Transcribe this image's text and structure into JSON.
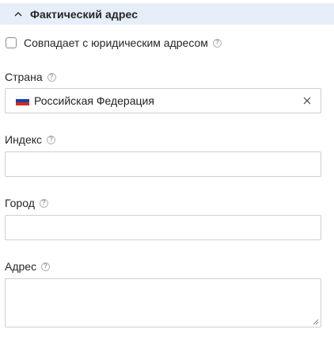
{
  "section": {
    "title": "Фактический адрес",
    "expanded": true
  },
  "same_as_legal": {
    "label": "Совпадает с юридическим адресом",
    "checked": false,
    "help": "?"
  },
  "country": {
    "label": "Страна",
    "help": "?",
    "value": "Российская Федерация",
    "flag_icon": "russia-flag-icon"
  },
  "index": {
    "label": "Индекс",
    "help": "?",
    "value": ""
  },
  "city": {
    "label": "Город",
    "help": "?",
    "value": ""
  },
  "address": {
    "label": "Адрес",
    "help": "?",
    "value": ""
  },
  "colors": {
    "header_bg": "#e6eef9",
    "border": "#cfcfcf",
    "flag_white": "#ffffff",
    "flag_blue": "#1c3fa6",
    "flag_red": "#d52b1e"
  }
}
